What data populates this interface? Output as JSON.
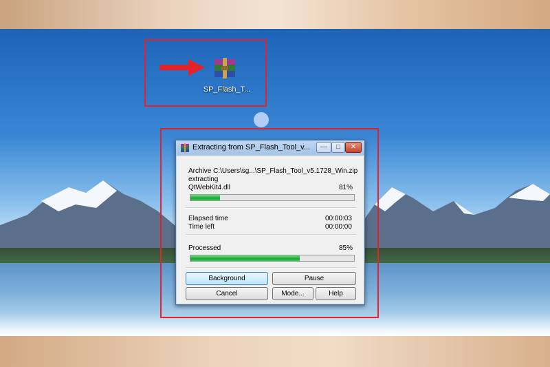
{
  "desktop": {
    "file_label": "SP_Flash_T..."
  },
  "dialog": {
    "title": "Extracting from SP_Flash_Tool_v...",
    "archive_line": "Archive C:\\Users\\sg...\\SP_Flash_Tool_v5.1728_Win.zip",
    "action": "extracting",
    "current_file": "QtWebKit4.dll",
    "file_percent_text": "81%",
    "file_progress": 0.18,
    "elapsed_label": "Elapsed time",
    "elapsed_value": "00:00:03",
    "timeleft_label": "Time left",
    "timeleft_value": "00:00:00",
    "processed_label": "Processed",
    "processed_percent_text": "85%",
    "processed_progress": 0.67,
    "buttons": {
      "background": "Background",
      "pause": "Pause",
      "cancel": "Cancel",
      "mode": "Mode...",
      "help": "Help"
    }
  },
  "colors": {
    "highlight_box": "#e3222b",
    "progress_fill": "#1ca33a"
  }
}
